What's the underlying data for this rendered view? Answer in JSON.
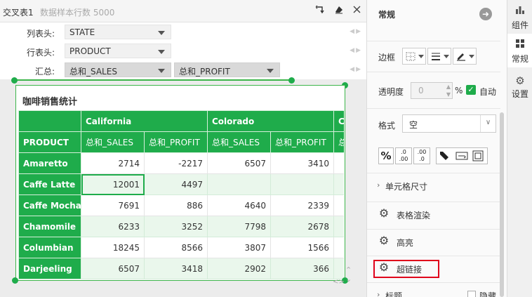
{
  "editor": {
    "title": "交叉表1",
    "sample_rows": "数据样本行数 5000"
  },
  "bindings": {
    "columns": {
      "label": "列表头:",
      "fields": [
        "STATE"
      ]
    },
    "rows": {
      "label": "行表头:",
      "fields": [
        "PRODUCT"
      ]
    },
    "summary": {
      "label": "汇总:",
      "fields": [
        "总和_SALES",
        "总和_PROFIT"
      ]
    }
  },
  "report": {
    "title": "咖啡销售统计",
    "states": [
      "California",
      "Colorado",
      "C"
    ],
    "row_header": "PRODUCT",
    "measures": [
      "总和_SALES",
      "总和_PROFIT"
    ],
    "rows": [
      {
        "product": "Amaretto",
        "values": [
          "2714",
          "-2217",
          "6507",
          "3410",
          ""
        ]
      },
      {
        "product": "Caffe Latte",
        "values": [
          "12001",
          "4497",
          "",
          "",
          ""
        ]
      },
      {
        "product": "Caffe Mocha",
        "values": [
          "7691",
          "886",
          "4640",
          "2339",
          ""
        ]
      },
      {
        "product": "Chamomile",
        "values": [
          "6233",
          "3252",
          "7798",
          "2678",
          ""
        ]
      },
      {
        "product": "Columbian",
        "values": [
          "18245",
          "8566",
          "3807",
          "1566",
          ""
        ]
      },
      {
        "product": "Darjeeling",
        "values": [
          "6507",
          "3418",
          "2902",
          "366",
          ""
        ]
      }
    ]
  },
  "panel": {
    "title": "常规",
    "border_label": "边框",
    "opacity_label": "透明度",
    "opacity_value": "0",
    "opacity_unit": "%",
    "auto_label": "自动",
    "format_label": "格式",
    "format_value": "空",
    "format_buttons": [
      "%",
      ".0 .00",
      ".00 .0"
    ],
    "sections": {
      "cell_size": "单元格尺寸",
      "table_render": "表格渲染",
      "highlight": "高亮",
      "hyperlink": "超链接",
      "caption": "标题",
      "hide": "隐藏"
    }
  },
  "tabs": [
    {
      "label": "组件",
      "icon": "bar-chart-icon"
    },
    {
      "label": "常规",
      "icon": "grid-icon"
    },
    {
      "label": "设置",
      "icon": "gear-icon"
    }
  ],
  "colors": {
    "accent": "#1fac4b",
    "highlight_box": "#e0001b"
  }
}
